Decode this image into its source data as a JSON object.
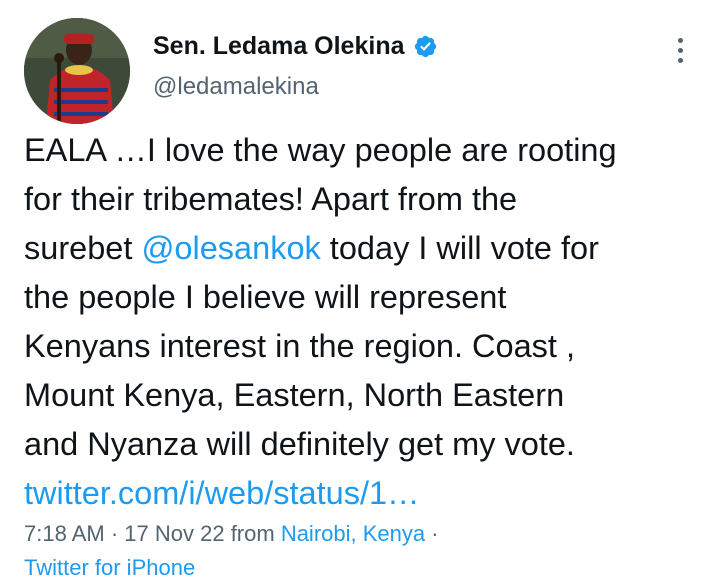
{
  "author": {
    "display_name": "Sen. Ledama Olekina",
    "handle": "@ledamalekina",
    "verified": true,
    "avatar_icon": "profile-photo"
  },
  "tweet": {
    "lines": [
      {
        "parts": [
          {
            "text": "EALA …I love the way people are rooting",
            "type": "text"
          }
        ]
      },
      {
        "parts": [
          {
            "text": "for their tribemates! Apart from the",
            "type": "text"
          }
        ]
      },
      {
        "parts": [
          {
            "text": "surebet ",
            "type": "text"
          },
          {
            "text": "@olesankok",
            "type": "mention"
          },
          {
            "text": " today I will vote for",
            "type": "text"
          }
        ]
      },
      {
        "parts": [
          {
            "text": "the people I believe will represent",
            "type": "text"
          }
        ]
      },
      {
        "parts": [
          {
            "text": "Kenyans interest in the region. Coast ,",
            "type": "text"
          }
        ]
      },
      {
        "parts": [
          {
            "text": "Mount Kenya, Eastern, North Eastern",
            "type": "text"
          }
        ]
      },
      {
        "parts": [
          {
            "text": "and Nyanza will definitely get my vote.",
            "type": "text"
          }
        ]
      },
      {
        "parts": [
          {
            "text": "twitter.com/i/web/status/1…",
            "type": "link"
          }
        ]
      }
    ]
  },
  "meta": {
    "time": "7:18 AM",
    "separator": " · ",
    "date": "17 Nov 22",
    "from_label": " from ",
    "location": "Nairobi, Kenya",
    "trailing_sep": " ·",
    "source": "Twitter for iPhone"
  },
  "colors": {
    "link": "#1d9bf0",
    "secondary_text": "#536471",
    "primary_text": "#0f1419",
    "verified_badge": "#1d9bf0"
  },
  "icons": {
    "more": "more-vertical-icon",
    "verified": "verified-badge-icon"
  }
}
